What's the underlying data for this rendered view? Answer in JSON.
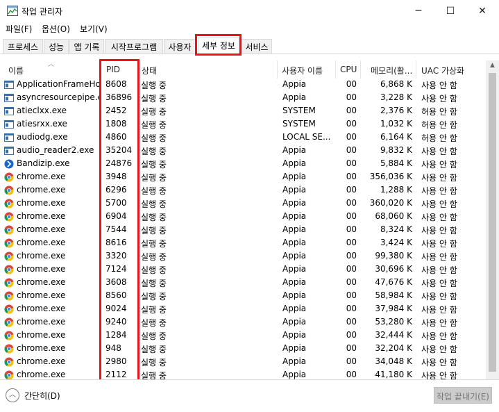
{
  "window": {
    "title": "작업 관리자",
    "minimize": "─",
    "maximize": "☐",
    "close": "✕"
  },
  "menu": [
    "파일(F)",
    "옵션(O)",
    "보기(V)"
  ],
  "tabs": [
    "프로세스",
    "성능",
    "앱 기록",
    "시작프로그램",
    "사용자",
    "세부 정보",
    "서비스"
  ],
  "active_tab": "세부 정보",
  "columns": {
    "name": "이름",
    "pid": "PID",
    "state": "상태",
    "user": "사용자 이름",
    "cpu": "CPU",
    "memory": "메모리(활...",
    "uac": "UAC 가상화"
  },
  "rows": [
    [
      "ApplicationFrameHo...",
      "8608",
      "실행 중",
      "Appia",
      "00",
      "6,868 K",
      "사용 안 함"
    ],
    [
      "asyncresourcepipe.exe",
      "36896",
      "실행 중",
      "Appia",
      "00",
      "3,228 K",
      "사용 안 함"
    ],
    [
      "atieclxx.exe",
      "2452",
      "실행 중",
      "SYSTEM",
      "00",
      "2,376 K",
      "허용 안 함"
    ],
    [
      "atiesrxx.exe",
      "1808",
      "실행 중",
      "SYSTEM",
      "00",
      "1,032 K",
      "허용 안 함"
    ],
    [
      "audiodg.exe",
      "4860",
      "실행 중",
      "LOCAL SE...",
      "00",
      "6,164 K",
      "허용 안 함"
    ],
    [
      "audio_reader2.exe",
      "35204",
      "실행 중",
      "Appia",
      "00",
      "9,832 K",
      "사용 안 함"
    ],
    [
      "Bandizip.exe",
      "24876",
      "실행 중",
      "Appia",
      "00",
      "5,884 K",
      "사용 안 함"
    ],
    [
      "chrome.exe",
      "3948",
      "실행 중",
      "Appia",
      "00",
      "356,036 K",
      "사용 안 함"
    ],
    [
      "chrome.exe",
      "6296",
      "실행 중",
      "Appia",
      "00",
      "1,288 K",
      "사용 안 함"
    ],
    [
      "chrome.exe",
      "5700",
      "실행 중",
      "Appia",
      "00",
      "360,020 K",
      "사용 안 함"
    ],
    [
      "chrome.exe",
      "6904",
      "실행 중",
      "Appia",
      "00",
      "68,060 K",
      "사용 안 함"
    ],
    [
      "chrome.exe",
      "7544",
      "실행 중",
      "Appia",
      "00",
      "8,324 K",
      "사용 안 함"
    ],
    [
      "chrome.exe",
      "8616",
      "실행 중",
      "Appia",
      "00",
      "3,424 K",
      "사용 안 함"
    ],
    [
      "chrome.exe",
      "3320",
      "실행 중",
      "Appia",
      "00",
      "99,380 K",
      "사용 안 함"
    ],
    [
      "chrome.exe",
      "7124",
      "실행 중",
      "Appia",
      "00",
      "30,696 K",
      "사용 안 함"
    ],
    [
      "chrome.exe",
      "3608",
      "실행 중",
      "Appia",
      "00",
      "47,676 K",
      "사용 안 함"
    ],
    [
      "chrome.exe",
      "8560",
      "실행 중",
      "Appia",
      "00",
      "58,984 K",
      "사용 안 함"
    ],
    [
      "chrome.exe",
      "9024",
      "실행 중",
      "Appia",
      "00",
      "37,984 K",
      "사용 안 함"
    ],
    [
      "chrome.exe",
      "9240",
      "실행 중",
      "Appia",
      "00",
      "53,280 K",
      "사용 안 함"
    ],
    [
      "chrome.exe",
      "1284",
      "실행 중",
      "Appia",
      "00",
      "32,444 K",
      "사용 안 함"
    ],
    [
      "chrome.exe",
      "948",
      "실행 중",
      "Appia",
      "00",
      "32,204 K",
      "사용 안 함"
    ],
    [
      "chrome.exe",
      "2980",
      "실행 중",
      "Appia",
      "00",
      "34,048 K",
      "사용 안 함"
    ],
    [
      "chrome.exe",
      "2112",
      "실행 중",
      "Appia",
      "00",
      "41,180 K",
      "사용 안 함"
    ]
  ],
  "row_icons": [
    "window-app-icon",
    "window-app-icon",
    "window-app-icon",
    "window-app-icon",
    "window-app-icon",
    "window-app-icon",
    "bandizip-icon",
    "chrome-icon",
    "chrome-icon",
    "chrome-icon",
    "chrome-icon",
    "chrome-icon",
    "chrome-icon",
    "chrome-icon",
    "chrome-icon",
    "chrome-icon",
    "chrome-icon",
    "chrome-icon",
    "chrome-icon",
    "chrome-icon",
    "chrome-icon",
    "chrome-icon",
    "chrome-icon"
  ],
  "footer": {
    "collapse_label": "간단히(D)",
    "end_task_label": "작업 끝내기(E)"
  },
  "colors": {
    "highlight_box": "#e8141c",
    "selected_tab_bg": "#ffffff"
  }
}
